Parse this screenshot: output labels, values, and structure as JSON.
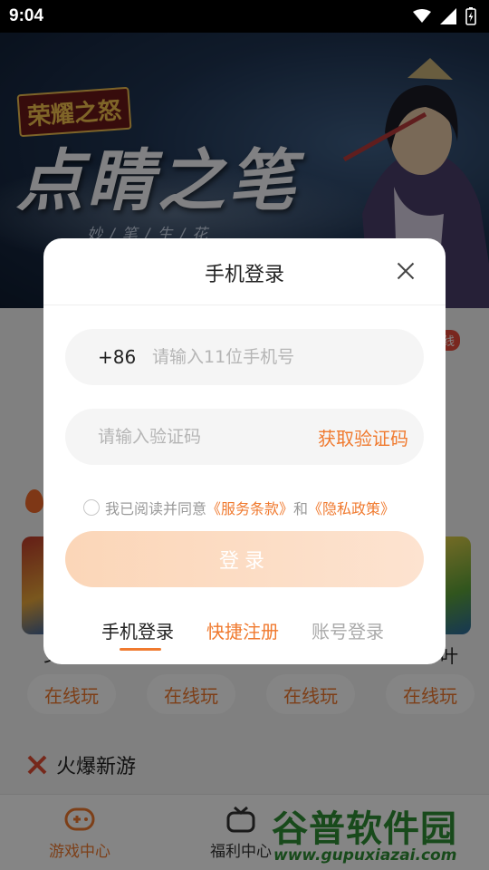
{
  "status_bar": {
    "time": "9:04",
    "icons": [
      "wifi-icon",
      "signal-icon",
      "battery-charging-icon"
    ]
  },
  "banner": {
    "game_logo": "荣耀之怒",
    "calligraphy": "点睛之笔",
    "subline": "妙/笔/生/花"
  },
  "background_page": {
    "badge_partial": "线",
    "card_text_left": "ン",
    "card_text_right": "叶",
    "play_buttons": [
      "在线玩",
      "在线玩",
      "在线玩",
      "在线玩"
    ],
    "section_title": "火爆新游"
  },
  "bottom_nav": {
    "items": [
      {
        "label": "游戏中心",
        "icon": "gamepad-icon",
        "active": true
      },
      {
        "label": "福利中心",
        "icon": "gift-tv-icon",
        "active": false
      }
    ]
  },
  "watermark": {
    "title": "谷普软件园",
    "url": "www.gupuxiazai.com"
  },
  "dialog": {
    "title": "手机登录",
    "phone_prefix": "+86",
    "phone_placeholder": "请输入11位手机号",
    "code_placeholder": "请输入验证码",
    "get_code": "获取验证码",
    "agree_text": "我已阅读并同意",
    "terms_link": "《服务条款》",
    "and": "和",
    "privacy_link": "《隐私政策》",
    "login_button": "登录",
    "tabs": [
      "手机登录",
      "快捷注册",
      "账号登录"
    ],
    "active_tab": "手机登录"
  },
  "colors": {
    "accent": "#f07a2f",
    "login_button_start": "#fbd6b8",
    "login_button_end": "#fde3d0",
    "badge": "#e94b3c"
  }
}
